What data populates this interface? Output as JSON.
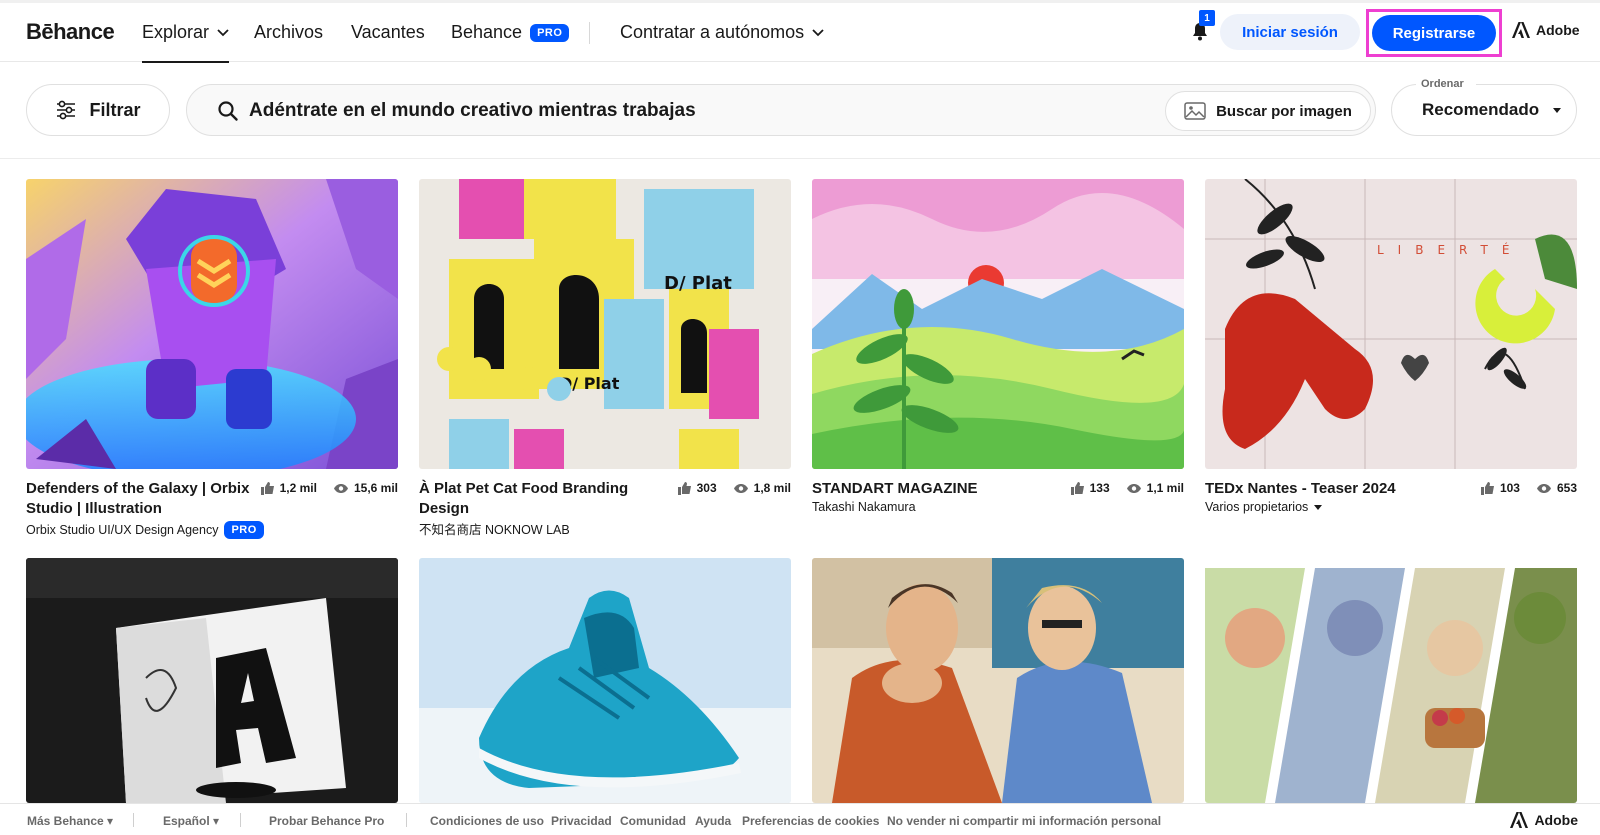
{
  "nav": {
    "logo": "Bēhance",
    "explore": "Explorar",
    "files": "Archivos",
    "jobs": "Vacantes",
    "behance_pro": "Behance",
    "pro_badge": "PRO",
    "hire": "Contratar a autónomos",
    "notification_count": "1",
    "login": "Iniciar sesión",
    "register": "Registrarse",
    "adobe": "Adobe"
  },
  "toolbar": {
    "filter": "Filtrar",
    "search_placeholder": "Adéntrate en el mundo creativo mientras trabajas",
    "image_search": "Buscar por imagen",
    "sort_label": "Ordenar",
    "sort_value": "Recomendado"
  },
  "projects": [
    {
      "title": "Defenders of the Galaxy | Orbix Studio | Illustration",
      "owner": "Orbix Studio UI/UX Design Agency",
      "owner_badge": "PRO",
      "likes": "1,2 mil",
      "views": "15,6 mil"
    },
    {
      "title": "À Plat Pet Cat Food Branding Design",
      "owner": "不知名商店 NOKNOW LAB",
      "likes": "303",
      "views": "1,8 mil"
    },
    {
      "title": "STANDART MAGAZINE",
      "owner": "Takashi Nakamura",
      "likes": "133",
      "views": "1,1 mil"
    },
    {
      "title": "TEDx Nantes - Teaser 2024",
      "owner": "Varios propietarios",
      "likes": "103",
      "views": "653"
    }
  ],
  "footer": {
    "more": "Más Behance",
    "language": "Español",
    "try_pro": "Probar Behance Pro",
    "terms": "Condiciones de uso",
    "privacy": "Privacidad",
    "community": "Comunidad",
    "help": "Ayuda",
    "cookies": "Preferencias de cookies",
    "do_not_sell": "No vender ni compartir mi información personal",
    "adobe": "Adobe"
  },
  "colors": {
    "brand_blue": "#0057ff",
    "highlight": "#ee3fd1"
  },
  "icons": [
    "chevron-down-icon",
    "bell-icon",
    "adobe-logo-icon",
    "filter-sliders-icon",
    "search-icon",
    "image-icon",
    "caret-down-icon",
    "thumbs-up-icon",
    "eye-icon"
  ]
}
